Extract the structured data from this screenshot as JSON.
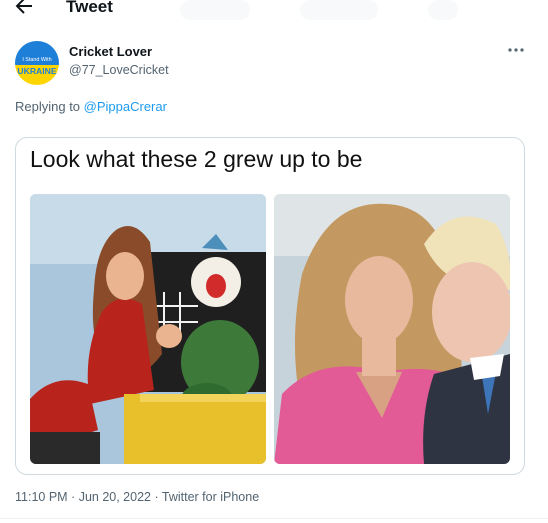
{
  "header": {
    "title": "Tweet",
    "back_icon": "arrow-left-icon"
  },
  "author": {
    "name": "Cricket Lover",
    "handle": "@77_LoveCricket",
    "avatar": {
      "line1": "I Stand With",
      "line2": "UKRAINE",
      "top_color": "#1d7fd8",
      "bottom_color": "#ffd500"
    }
  },
  "reply": {
    "prefix": "Replying to ",
    "to": "@PippaCrerar"
  },
  "media": {
    "caption": "Look what these 2 grew up to be"
  },
  "footer": {
    "time": "11:10 PM",
    "sep1": " · ",
    "date": "Jun 20, 2022",
    "sep2": " · ",
    "client": "Twitter for iPhone"
  },
  "colors": {
    "accent": "#1d9bf0",
    "text": "#0f1419",
    "muted": "#536471",
    "border": "#cfd9de"
  }
}
